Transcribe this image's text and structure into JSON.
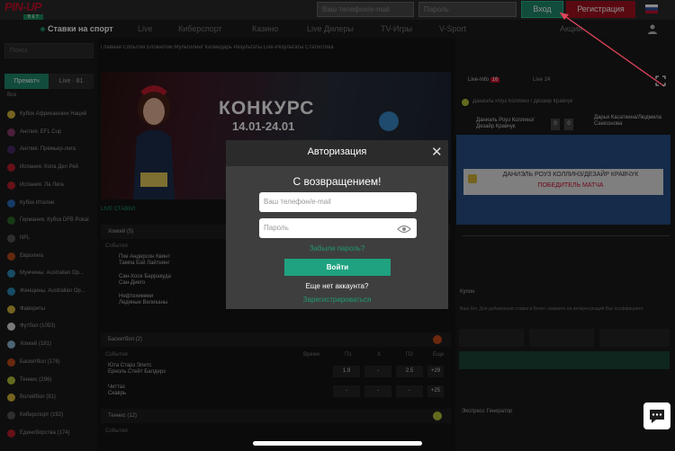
{
  "header": {
    "logo": "PIN-UP",
    "logo_sub": "B E T",
    "phone_placeholder": "Ваш телефон/e-mail",
    "password_placeholder": "Пароль",
    "login_button": "Вход",
    "register_button": "Регистрация"
  },
  "nav": {
    "items": [
      "Ставки на спорт",
      "Live",
      "Киберспорт",
      "Казино",
      "Live Дилеры",
      "TV-Игры",
      "V-Sport",
      "Акции"
    ]
  },
  "subnav": {
    "items": [
      "Главная",
      "События",
      "Блокнотик",
      "Мультилинг",
      "Календарь",
      "Результаты",
      "Live-Результаты",
      "Статистика"
    ]
  },
  "sidebar": {
    "search_placeholder": "Поиск",
    "tabs": [
      "Прематч",
      "Live · 81"
    ],
    "all_label": "Все",
    "items": [
      {
        "label": "Кубок Африканских Наций",
        "count": ""
      },
      {
        "label": "Англия. EFL Cup",
        "count": ""
      },
      {
        "label": "Англия. Премьер-лига",
        "count": ""
      },
      {
        "label": "Испания. Копа Дел Рей",
        "count": ""
      },
      {
        "label": "Испания. Ла Лига",
        "count": ""
      },
      {
        "label": "Кубок Италии",
        "count": ""
      },
      {
        "label": "Германия. Кубок DFB Pokal",
        "count": ""
      },
      {
        "label": "NFL",
        "count": ""
      },
      {
        "label": "Евролига",
        "count": ""
      },
      {
        "label": "Мужчины. Australian Op...",
        "count": ""
      },
      {
        "label": "Женщины. Australian Op...",
        "count": ""
      },
      {
        "label": "Фавориты",
        "count": ""
      },
      {
        "label": "Футбол (1053)",
        "count": ""
      },
      {
        "label": "Хоккей (181)",
        "count": ""
      },
      {
        "label": "Баскетбол (176)",
        "count": ""
      },
      {
        "label": "Теннис (296)",
        "count": ""
      },
      {
        "label": "Волейбол (81)",
        "count": ""
      },
      {
        "label": "Киберспорт (192)",
        "count": ""
      },
      {
        "label": "Единоборства (174)",
        "count": ""
      }
    ]
  },
  "banner": {
    "title": "КОНКУРС",
    "dates": "14.01-24.01"
  },
  "main": {
    "live_label": "LIVE СТАВКИ",
    "sections": [
      {
        "name": "Хоккей",
        "count": "5"
      },
      {
        "name": "Баскетбол",
        "count": "2"
      },
      {
        "name": "Теннис",
        "count": "12"
      }
    ],
    "headers": [
      "События",
      "Время",
      "П1",
      "Х",
      "П2",
      "Еще"
    ],
    "rows_hockey": [
      "Пхе Андерсон Квинт",
      "Тампа Бэй Лайтнинг",
      "Сан-Хосе Барракуда",
      "Сан-Диего",
      "Нефтехимики",
      "Ледяные Великаны"
    ],
    "rows_basket": [
      "Юта Старз Элитс",
      "Ерноль Стейт Балдерз",
      "Читтаз",
      "Скаврь"
    ],
    "odds": [
      "1.9",
      "-",
      "2.5",
      "+29",
      "+25",
      "+29"
    ]
  },
  "right": {
    "live_info": "Live-Info",
    "live_info_count": "16",
    "live_count": "24",
    "match_title": "Даниэль Роуз Коллинз / Дезайр Кравчук",
    "winner_line1": "ДАНИЭЛЬ РОУЗ КОЛЛИНЗ/ДЕЗАЙР КРАВЧУК",
    "winner_line2": "ПОБЕДИТЕЛЬ МАТЧА",
    "score_left": "0",
    "score_right": "0",
    "player1": "Даниэль Роуз Коллинз/Дезайр Кравчук",
    "player2": "Дарья Касаткина/Людмила Самсонова",
    "coupon_label": "Купон",
    "coupon_text": "Ваш бет. Для добавления ставки в билет, нажмите на интересующий Вас коэффициент.",
    "express_label": "Экспресс Генератор"
  },
  "modal": {
    "title": "Авторизация",
    "welcome": "С возвращением!",
    "phone_placeholder": "Ваш телефон/e-mail",
    "password_placeholder": "Пароль",
    "forgot": "Забыли пароль?",
    "enter_button": "Войти",
    "no_account": "Еще нет аккаунта?",
    "register_link": "Зарегистрироваться"
  },
  "colors": {
    "accent_green": "#1fa27f",
    "brand_red": "#c8102e",
    "annotation_arrow": "#e0455a"
  }
}
